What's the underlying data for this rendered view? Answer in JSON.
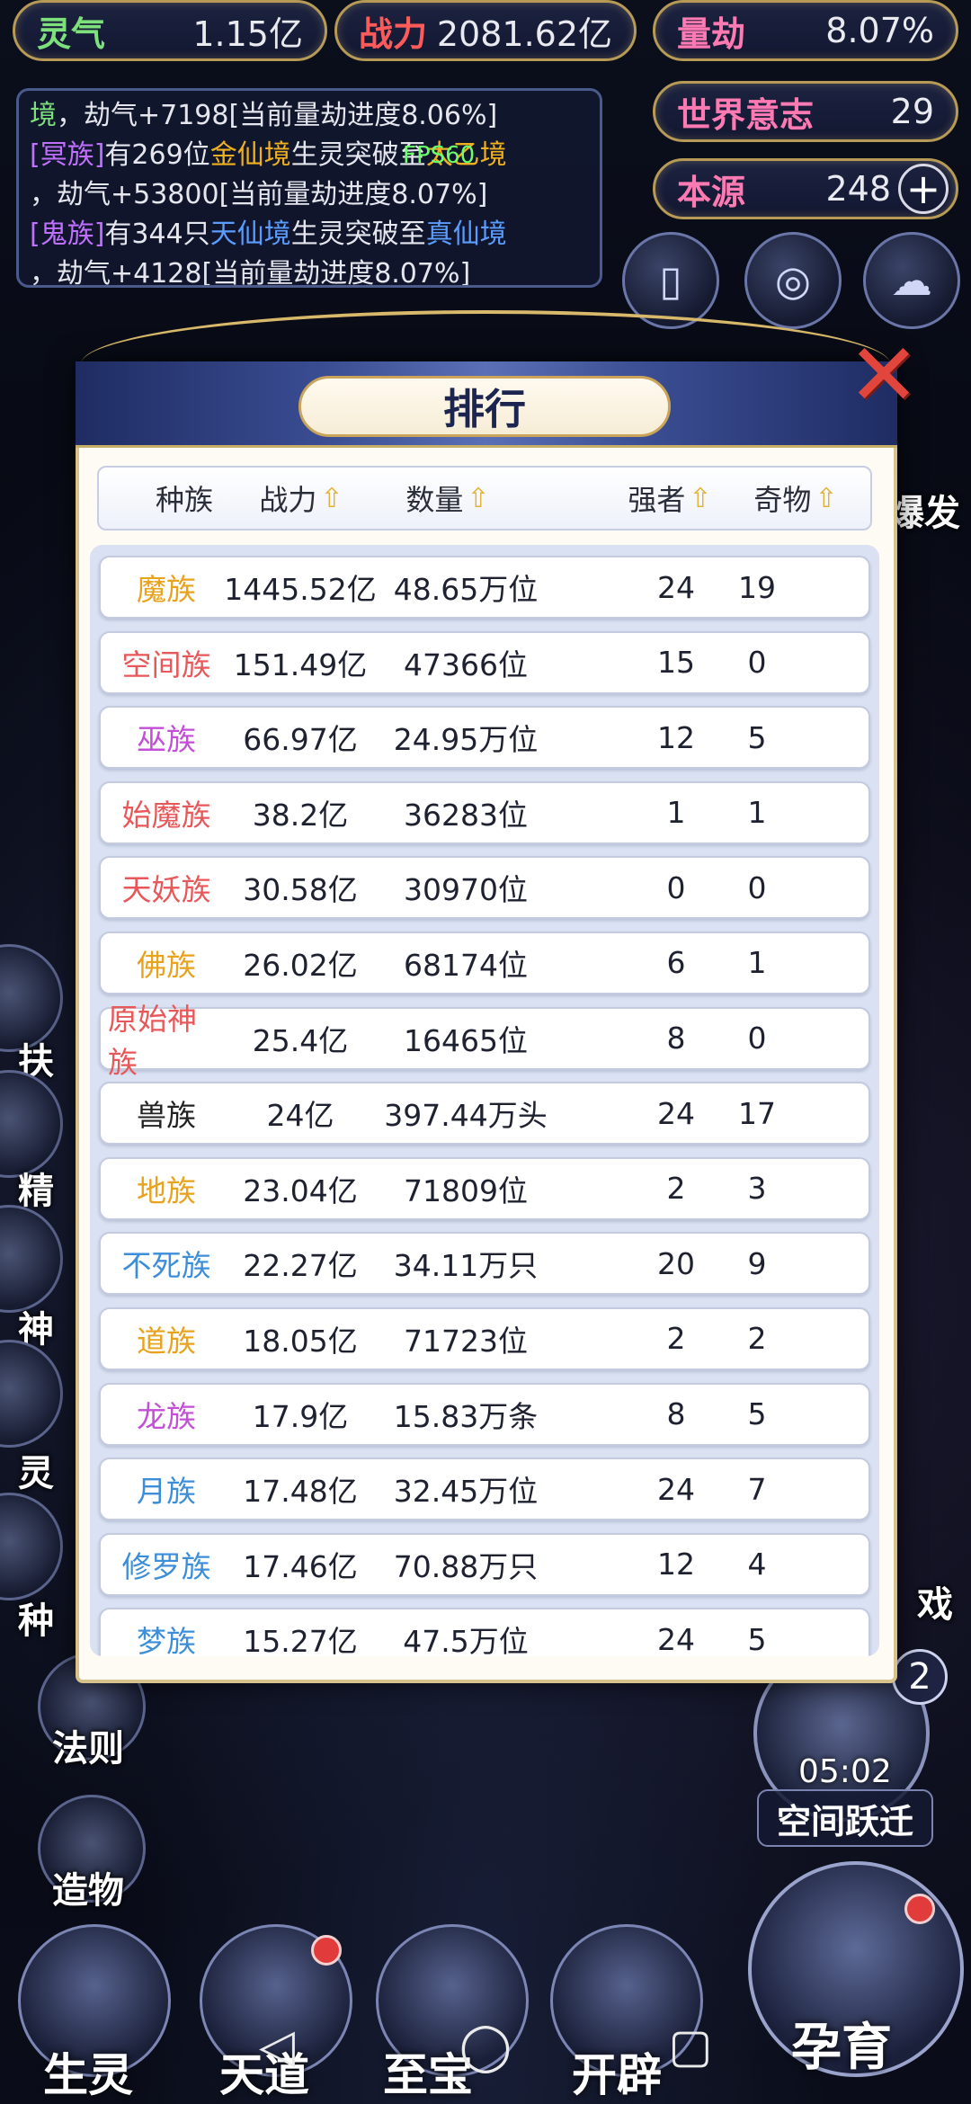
{
  "top_stats": {
    "lingqi": {
      "label": "灵气",
      "value": "1.15亿"
    },
    "zhanli": {
      "label": "战力",
      "value": "2081.62亿"
    },
    "liangjie": {
      "label": "量劫",
      "value": "8.07%"
    },
    "shijie_yizhi": {
      "label": "世界意志",
      "value": "29"
    },
    "benyuan": {
      "label": "本源",
      "value": "248",
      "plus": "+"
    }
  },
  "log": {
    "line1": [
      "境",
      "，劫气+7198[当前量劫进度8.06%]"
    ],
    "line2": [
      "[冥族]",
      "有269位",
      "金仙境",
      "生灵突破至",
      "太乙境"
    ],
    "line3": [
      "，劫气+53800[当前量劫进度8.07%]"
    ],
    "line4": [
      "[鬼族]",
      "有344只",
      "天仙境",
      "生灵突破至",
      "真仙境"
    ],
    "line5": [
      "，劫气+4128[当前量劫进度8.07%]"
    ]
  },
  "fps": "FPS60",
  "side": {
    "right_label": "爆发",
    "left_labels": [
      "扶",
      "精",
      "神",
      "灵",
      "种"
    ],
    "fa_ze": "法则",
    "zao_wu": "造物",
    "right_mid": "戏",
    "badge": "2",
    "timer": "05:02",
    "space_jump": "空间跃迁"
  },
  "bottom": {
    "items": [
      "生灵",
      "天道",
      "至宝",
      "开辟"
    ],
    "big": "孕育"
  },
  "modal": {
    "title": "排行",
    "close": "✕",
    "columns": [
      "种族",
      "战力",
      "数量",
      "强者",
      "奇物"
    ],
    "sort_icon": "⇧",
    "rows": [
      {
        "race": "魔族",
        "color": "#e8a21c",
        "power": "1445.52亿",
        "count": "48.65万位",
        "strong": "24",
        "items": "19"
      },
      {
        "race": "空间族",
        "color": "#e8585a",
        "power": "151.49亿",
        "count": "47366位",
        "strong": "15",
        "items": "0"
      },
      {
        "race": "巫族",
        "color": "#c24fd6",
        "power": "66.97亿",
        "count": "24.95万位",
        "strong": "12",
        "items": "5"
      },
      {
        "race": "始魔族",
        "color": "#e8585a",
        "power": "38.2亿",
        "count": "36283位",
        "strong": "1",
        "items": "1"
      },
      {
        "race": "天妖族",
        "color": "#e8585a",
        "power": "30.58亿",
        "count": "30970位",
        "strong": "0",
        "items": "0"
      },
      {
        "race": "佛族",
        "color": "#e8a21c",
        "power": "26.02亿",
        "count": "68174位",
        "strong": "6",
        "items": "1"
      },
      {
        "race": "原始神族",
        "color": "#e8585a",
        "power": "25.4亿",
        "count": "16465位",
        "strong": "8",
        "items": "0"
      },
      {
        "race": "兽族",
        "color": "#222222",
        "power": "24亿",
        "count": "397.44万头",
        "strong": "24",
        "items": "17"
      },
      {
        "race": "地族",
        "color": "#e8a21c",
        "power": "23.04亿",
        "count": "71809位",
        "strong": "2",
        "items": "3"
      },
      {
        "race": "不死族",
        "color": "#3d8ed8",
        "power": "22.27亿",
        "count": "34.11万只",
        "strong": "20",
        "items": "9"
      },
      {
        "race": "道族",
        "color": "#e8a21c",
        "power": "18.05亿",
        "count": "71723位",
        "strong": "2",
        "items": "2"
      },
      {
        "race": "龙族",
        "color": "#c24fd6",
        "power": "17.9亿",
        "count": "15.83万条",
        "strong": "8",
        "items": "5"
      },
      {
        "race": "月族",
        "color": "#3d8ed8",
        "power": "17.48亿",
        "count": "32.45万位",
        "strong": "24",
        "items": "7"
      },
      {
        "race": "修罗族",
        "color": "#3d8ed8",
        "power": "17.46亿",
        "count": "70.88万只",
        "strong": "12",
        "items": "4"
      },
      {
        "race": "梦族",
        "color": "#3d8ed8",
        "power": "15.27亿",
        "count": "47.5万位",
        "strong": "24",
        "items": "5"
      }
    ]
  },
  "nav": {
    "back": "◁",
    "home": "◯",
    "recent": "▢"
  }
}
